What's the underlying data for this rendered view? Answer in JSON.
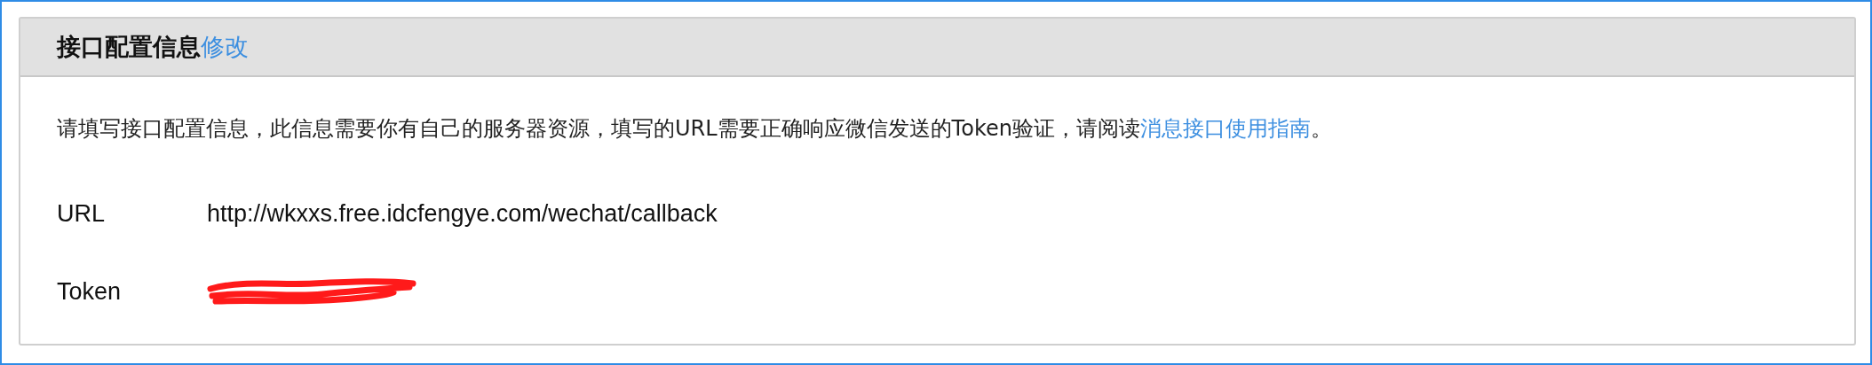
{
  "panel": {
    "title": "接口配置信息",
    "edit_link": "修改"
  },
  "description": {
    "text": "请填写接口配置信息，此信息需要你有自己的服务器资源，填写的URL需要正确响应微信发送的Token验证，请阅读",
    "link": "消息接口使用指南",
    "end": "。"
  },
  "fields": [
    {
      "label": "URL",
      "kind": "text",
      "value": "http://wkxxs.free.idcfengye.com/wechat/callback"
    },
    {
      "label": "Token",
      "kind": "redacted"
    }
  ]
}
